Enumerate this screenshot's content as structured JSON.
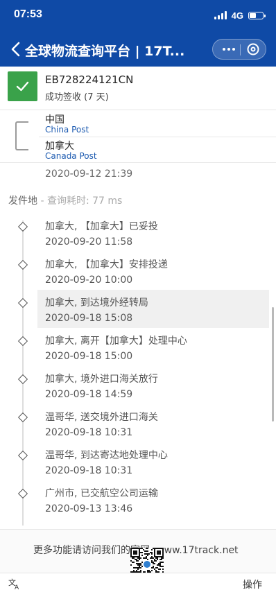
{
  "status_bar": {
    "time": "07:53",
    "network": "4G",
    "battery_level": 0.55
  },
  "nav": {
    "title": "全球物流查询平台 | 17T..."
  },
  "package": {
    "tracking_number": "EB728224121CN",
    "status": "成功签收 (7 天)",
    "status_color": "#3aa24a"
  },
  "carriers": {
    "origin_country": "中国",
    "origin_carrier": "China Post",
    "destination_country": "加拿大",
    "destination_carrier": "Canada Post"
  },
  "previous_event_time": "2020-09-12 21:39",
  "section": {
    "title": "发件地",
    "subtitle": " - 查询耗时:  77 ms"
  },
  "events": [
    {
      "desc": "加拿大, 【加拿大】已妥投",
      "time": "2020-09-20 11:58",
      "highlighted": false
    },
    {
      "desc": "加拿大, 【加拿大】安排投递",
      "time": "2020-09-20 10:00",
      "highlighted": false
    },
    {
      "desc": "加拿大, 到达境外经转局",
      "time": "2020-09-18 15:08",
      "highlighted": true
    },
    {
      "desc": "加拿大, 离开【加拿大】处理中心",
      "time": "2020-09-18 15:00",
      "highlighted": false
    },
    {
      "desc": "加拿大, 境外进口海关放行",
      "time": "2020-09-18 14:59",
      "highlighted": false
    },
    {
      "desc": "温哥华, 送交境外进口海关",
      "time": "2020-09-18 10:31",
      "highlighted": false
    },
    {
      "desc": "温哥华, 到达寄达地处理中心",
      "time": "2020-09-18 10:31",
      "highlighted": false
    },
    {
      "desc": "广州市, 已交航空公司运输",
      "time": "2020-09-13 13:46",
      "highlighted": false
    }
  ],
  "promo": {
    "text": "更多功能请访问我们的官网: www.17track.net"
  },
  "bottom": {
    "operations_label": "操作"
  },
  "colors": {
    "brand": "#0f4aa6",
    "link": "#1c5ab0"
  }
}
